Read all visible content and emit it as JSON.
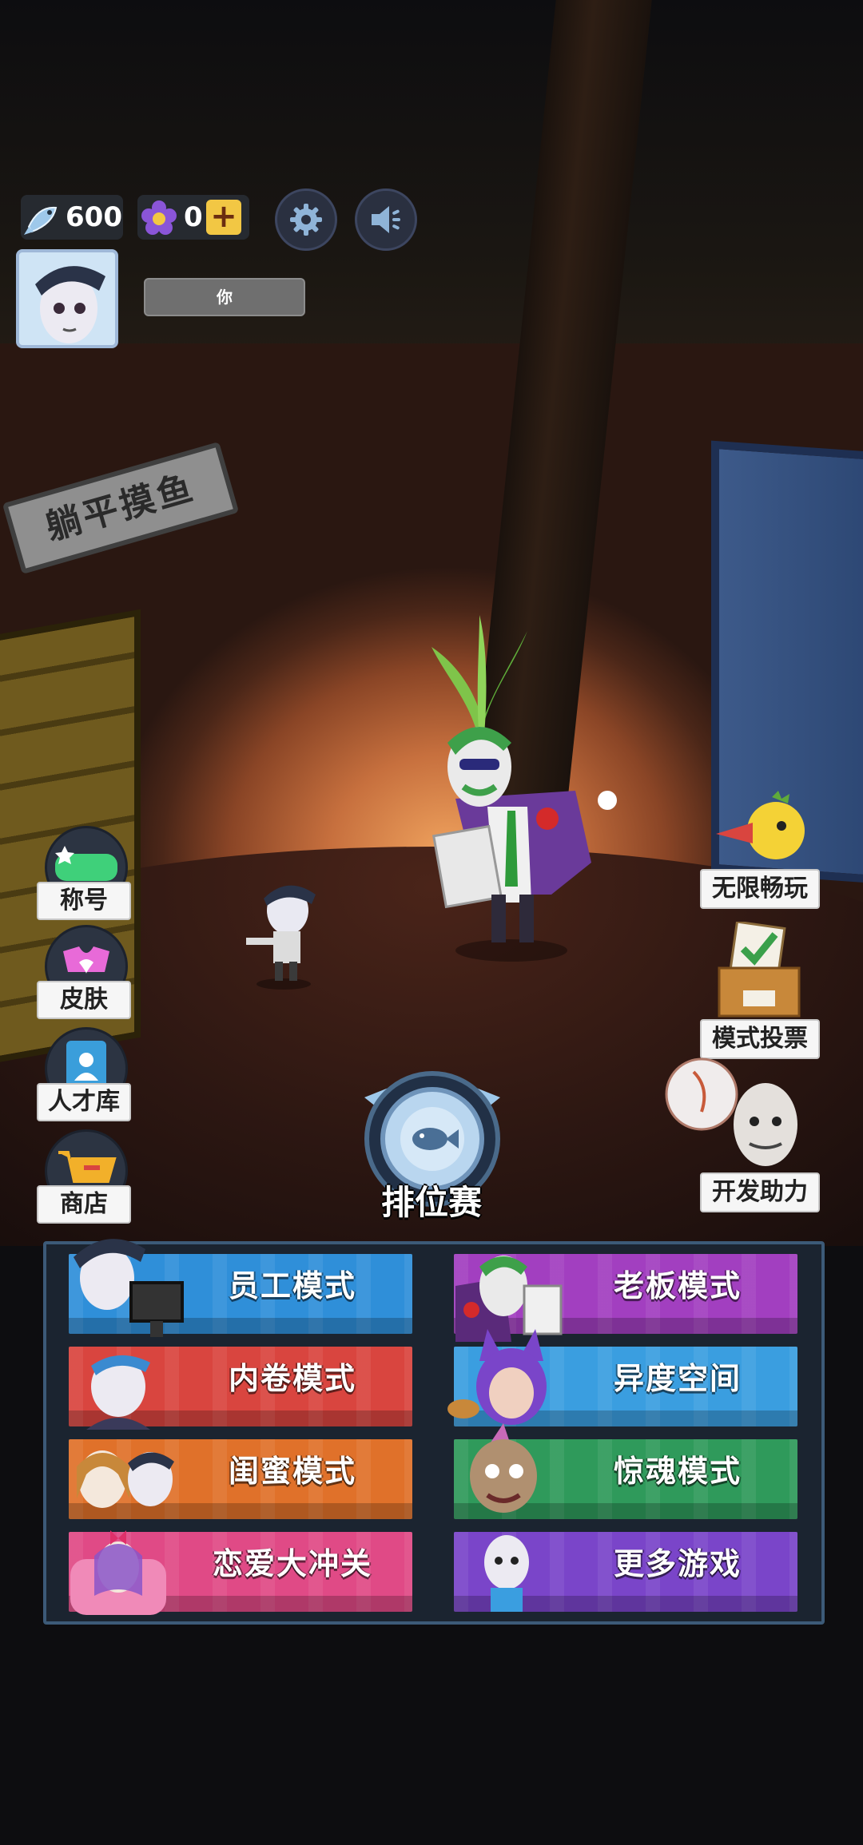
{
  "currency": {
    "fish": {
      "icon": "fish-icon",
      "value": "600"
    },
    "flower": {
      "icon": "flower-icon",
      "value": "0"
    }
  },
  "player": {
    "name": "你"
  },
  "scene": {
    "sign_text": "躺平摸鱼"
  },
  "left_menu": [
    {
      "id": "title",
      "label": "称号",
      "icon": "title-badge-icon"
    },
    {
      "id": "skin",
      "label": "皮肤",
      "icon": "heart-skin-icon"
    },
    {
      "id": "talent",
      "label": "人才库",
      "icon": "talent-book-icon"
    },
    {
      "id": "shop",
      "label": "商店",
      "icon": "shop-cart-icon"
    }
  ],
  "right_menu": [
    {
      "id": "unlimited",
      "label": "无限畅玩",
      "icon": "duck-horn-icon"
    },
    {
      "id": "vote",
      "label": "模式投票",
      "icon": "ballot-box-icon"
    },
    {
      "id": "support",
      "label": "开发助力",
      "icon": "developer-icon"
    }
  ],
  "ranked": {
    "label": "排位赛",
    "icon": "fish-rank-badge-icon"
  },
  "modes": [
    {
      "id": "employee",
      "label": "员工模式",
      "color": "#2f8fd9"
    },
    {
      "id": "boss",
      "label": "老板模式",
      "color": "#a23fc0"
    },
    {
      "id": "involution",
      "label": "内卷模式",
      "color": "#d9453f"
    },
    {
      "id": "dimension",
      "label": "异度空间",
      "color": "#3a9ee0"
    },
    {
      "id": "bestie",
      "label": "闺蜜模式",
      "color": "#e0712a"
    },
    {
      "id": "horror",
      "label": "惊魂模式",
      "color": "#2f9a5b"
    },
    {
      "id": "love",
      "label": "恋爱大冲关",
      "color": "#e04a86"
    },
    {
      "id": "more",
      "label": "更多游戏",
      "color": "#7a45c9"
    }
  ]
}
